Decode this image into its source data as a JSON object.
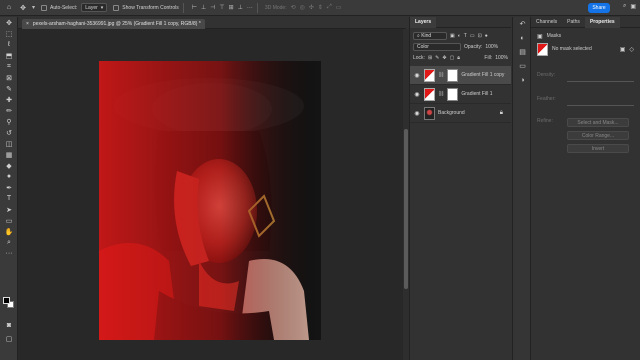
{
  "options_bar": {
    "auto_select_label": "Auto-Select:",
    "auto_select_value": "Layer",
    "transform_label": "Show Transform Controls",
    "mode_3d": "3D Mode:",
    "share_label": "Share"
  },
  "document": {
    "tab_title": "pexels-arsham-haghani-3536991.jpg @ 25% (Gradient Fill 1 copy, RGB/8) *",
    "close_glyph": "×"
  },
  "layers_panel": {
    "tab_label": "Layers",
    "filter_value": "Kind",
    "blend_mode": "Color",
    "opacity_label": "Opacity:",
    "opacity_value": "100%",
    "lock_label": "Lock:",
    "fill_label": "Fill:",
    "fill_value": "100%",
    "layers": [
      {
        "name": "Gradient Fill 1 copy",
        "selected": true
      },
      {
        "name": "Gradient Fill 1",
        "selected": false
      },
      {
        "name": "Background",
        "selected": false
      }
    ]
  },
  "properties_panel": {
    "tabs": [
      "Channels",
      "Paths",
      "Properties"
    ],
    "section_title": "Masks",
    "mask_status": "No mask selected",
    "density_label": "Density:",
    "feather_label": "Feather:",
    "refine_label": "Refine:",
    "select_mask_label": "Select and Mask...",
    "color_range_label": "Color Range...",
    "invert_label": "Invert"
  },
  "colors": {
    "accent": "#1473e6",
    "red_overlay": "#e01818",
    "selected_layer_bg": "#4a4a4a"
  }
}
